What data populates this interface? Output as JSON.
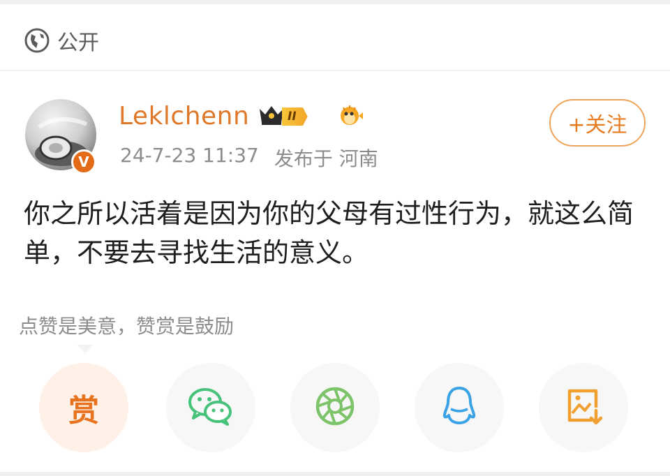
{
  "visibility": {
    "label": "公开",
    "icon": "globe-icon"
  },
  "author": {
    "name": "Leklchenn",
    "vip_level": "II",
    "verified_badge": "V",
    "avatar": "avatar",
    "timestamp": "24-7-23 11:37",
    "location": "发布于 河南"
  },
  "follow_button": {
    "label": "+关注"
  },
  "post": {
    "text": "你之所以活着是因为你的父母有过性行为，就这么简单，不要去寻找生活的意义。"
  },
  "reward_tip": "点赞是美意，赞赏是鼓励",
  "share_actions": [
    {
      "name": "reward",
      "label": "赏",
      "icon": "reward-icon"
    },
    {
      "name": "wechat",
      "icon": "wechat-icon"
    },
    {
      "name": "moments",
      "icon": "moments-icon"
    },
    {
      "name": "qq",
      "icon": "qq-icon"
    },
    {
      "name": "save-image",
      "icon": "save-image-icon"
    }
  ],
  "colors": {
    "accent": "#e57c22",
    "username": "#e0782a",
    "wechat": "#46c27a",
    "moments": "#7dc36a",
    "qq": "#3aa3e6",
    "save": "#f0a030"
  }
}
